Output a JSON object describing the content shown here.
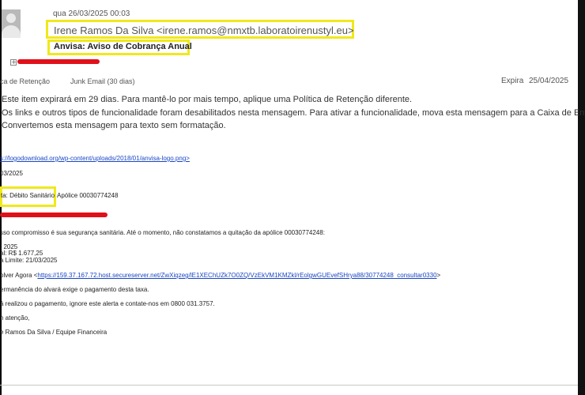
{
  "header": {
    "date": "qua 26/03/2025 00:03",
    "from": "Irene Ramos Da Silva <irene.ramos@nmxtb.laboratoirenustyl.eu>",
    "subject": "Anvisa: Aviso de Cobrança Anual"
  },
  "meta": {
    "retention_label": "ca de Retenção",
    "folder_label": "Junk Email (30 dias)",
    "expira_label": "Expira",
    "expira_date": "25/04/2025"
  },
  "info_bar": {
    "line1": "Este item expirará em 29 dias. Para mantê-lo por mais tempo, aplique uma Política de Retenção diferente.",
    "line2": "Os links e outros tipos de funcionalidade foram desabilitados nesta mensagem. Para ativar a funcionalidade, mova esta mensagem para a Caixa de Entrada.",
    "line3": "Convertemos esta mensagem para texto sem formatação."
  },
  "body": {
    "logo_link": "s://logodownload.org/wp-content/uploads/2018/01/anvisa-logo.png>",
    "date": "03/2025",
    "debit_label": "ta: Débito Sanitário",
    "policy": "Apólice 00030774248",
    "intro": "sso compromisso é sua segurança sanitária. Até o momento, não constatamos a quitação da apólice 00030774248:",
    "year": ": 2025",
    "amount": "al: R$ 1.677,25",
    "due": "a Limite: 21/03/2025",
    "resolve_prefix": "olver Agora <",
    "resolve_link": "https://159.37.167.72.host.secureserver.net/ZwXiqzeg/lE1XEChUZk7O0ZQ/VzEkVM1KMZkl/rEolgwGUEvefSHrya88/30774248_consultar0330",
    "resolve_suffix": ">",
    "permanence": "ermanência do alvará exige o pagamento desta taxa.",
    "already_paid": "á realizou o pagamento, ignore este alerta e contate-nos em 0800 031.3757.",
    "regards": "n atenção,",
    "signature": "e Ramos Da Silva / Equipe Financeira"
  },
  "colors": {
    "highlight_box": "#f0e81c",
    "redaction": "#e0101a",
    "link": "#1a46c4"
  },
  "icons": {
    "avatar": "person-silhouette-icon",
    "expand": "plus-square-icon"
  }
}
